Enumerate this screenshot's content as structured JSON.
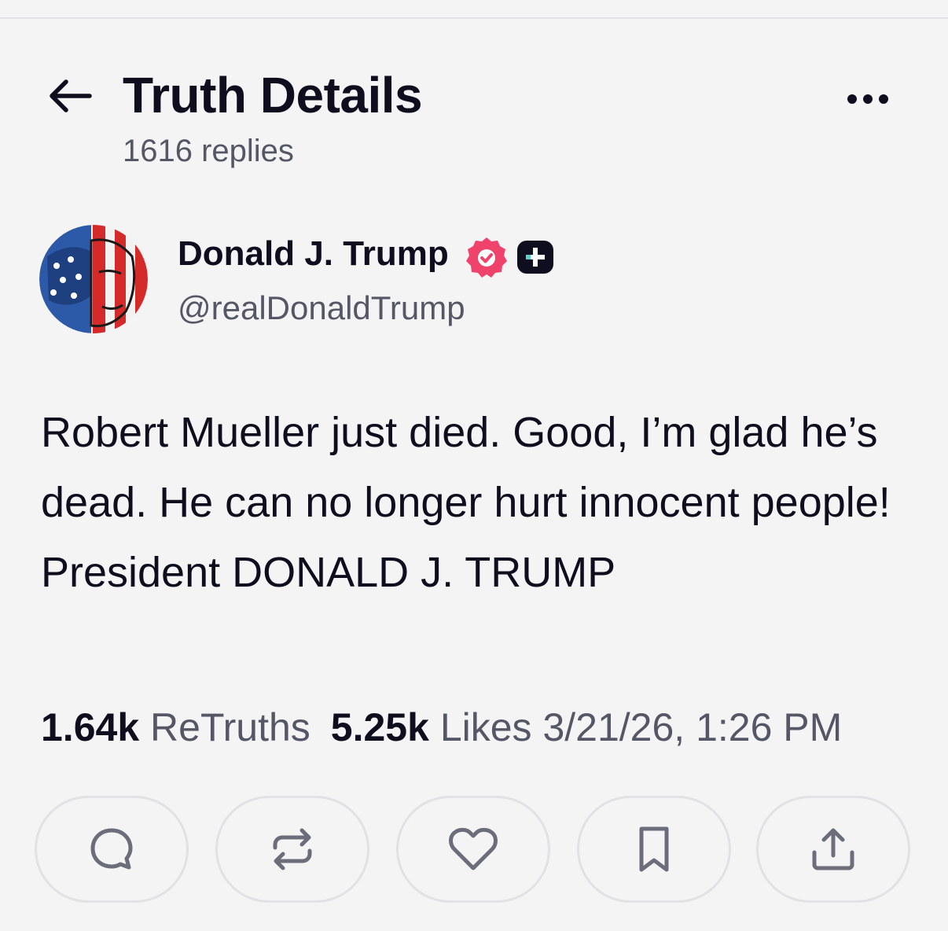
{
  "header": {
    "title": "Truth Details",
    "subtitle": "1616 replies",
    "back_icon": "arrow-left-icon",
    "more_icon": "more-dots-icon"
  },
  "post": {
    "author": {
      "name": "Donald J. Trump",
      "handle": "@realDonaldTrump",
      "verified_icon": "verified-badge-icon",
      "verified_color": "#f0436b",
      "plus_icon": "truth-plus-badge-icon"
    },
    "content": "Robert Mueller just died. Good, I’m glad he’s dead. He can no longer hurt innocent people! President DONALD J. TRUMP",
    "stats": {
      "retruths_count": "1.64k",
      "retruths_label": "ReTruths",
      "likes_count": "5.25k",
      "likes_label": "Likes",
      "timestamp": "3/21/26, 1:26 PM"
    }
  },
  "actions": [
    {
      "icon": "reply-icon"
    },
    {
      "icon": "retruth-icon"
    },
    {
      "icon": "like-heart-icon"
    },
    {
      "icon": "bookmark-icon"
    },
    {
      "icon": "share-icon"
    }
  ],
  "colors": {
    "background": "#f4f4f5",
    "text_primary": "#0e0e1f",
    "text_secondary": "#555766",
    "icon_gray": "#6b6d7a",
    "border": "#e2e2e6"
  }
}
